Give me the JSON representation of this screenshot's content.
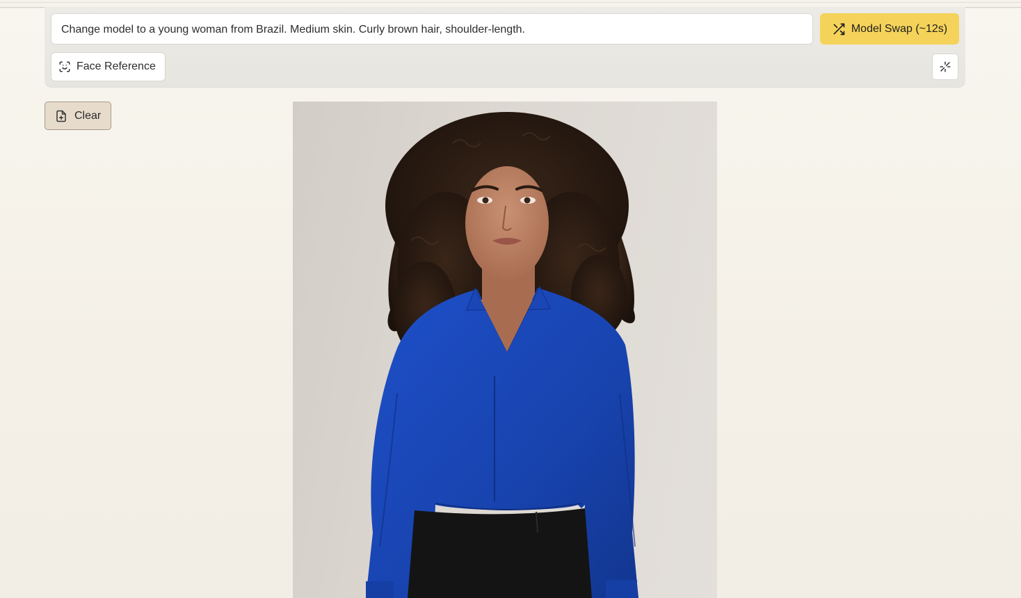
{
  "prompt": {
    "value": "Change model to a young woman from Brazil. Medium skin. Curly brown hair, shoulder-length."
  },
  "buttons": {
    "model_swap_label": "Model Swap (~12s)",
    "face_reference_label": "Face Reference",
    "clear_label": "Clear"
  },
  "icons": {
    "model_swap": "shuffle-icon",
    "face_reference": "face-scan-icon",
    "sparkle": "sparkle-icon",
    "clear": "file-plus-icon"
  },
  "colors": {
    "accent": "#f5d35a",
    "clear_bg": "#e7dccb",
    "blouse": "#1a47b8"
  }
}
